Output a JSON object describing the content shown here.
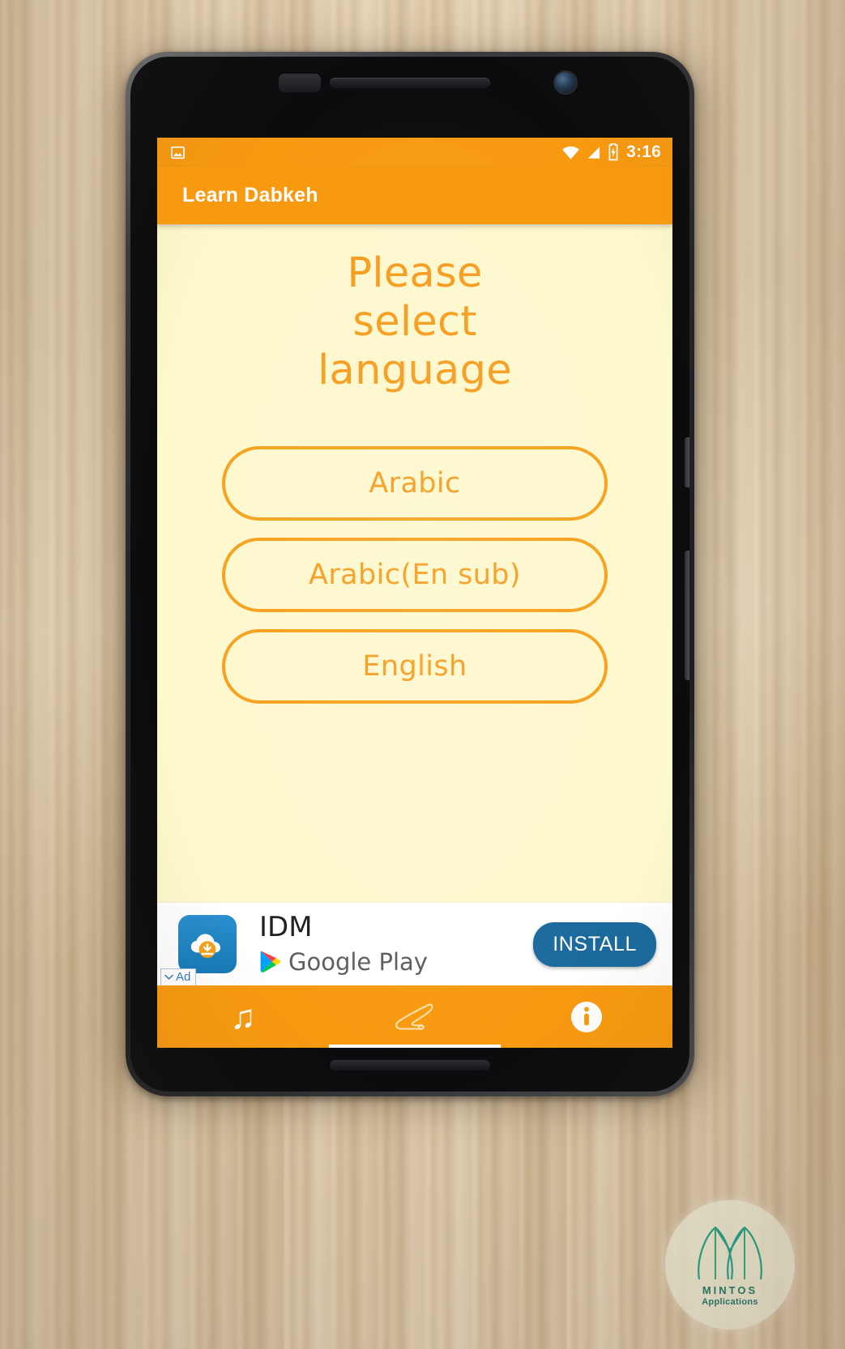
{
  "status_bar": {
    "time": "3:16",
    "left_icons": [
      "image-icon"
    ],
    "right_icons": [
      "wifi-icon",
      "signal-icon",
      "battery-charging-icon"
    ]
  },
  "app_bar": {
    "title": "Learn Dabkeh",
    "background": "#f89a10",
    "title_color": "#ffffff"
  },
  "content": {
    "prompt": "Please select language",
    "background": "#fdf8cd",
    "accent": "#f69b1b",
    "language_buttons": [
      {
        "label": "Arabic"
      },
      {
        "label": "Arabic(En sub)"
      },
      {
        "label": "English"
      }
    ]
  },
  "ad_banner": {
    "app_name": "IDM",
    "store": "Google Play",
    "install_label": "INSTALL",
    "badge_label": "Ad",
    "install_color": "#1b6a9e",
    "icon": "idm-download-cloud-icon"
  },
  "bottom_nav": {
    "background": "#f89a10",
    "items": [
      {
        "name": "music",
        "icon": "music-note-icon",
        "selected": false
      },
      {
        "name": "dance-shoe",
        "icon": "dabkeh-shoe-icon",
        "selected": true
      },
      {
        "name": "info",
        "icon": "info-circle-icon",
        "selected": false
      }
    ]
  },
  "watermark": {
    "name": "MINTOS",
    "subtitle": "Applications",
    "color": "#1f7a6d"
  }
}
